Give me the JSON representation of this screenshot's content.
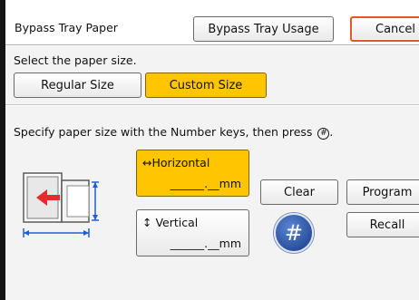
{
  "header": {
    "title": "Bypass Tray Paper",
    "usage_button": "Bypass Tray Usage",
    "cancel_button": "Cancel"
  },
  "paper_size": {
    "prompt": "Select the paper size.",
    "options": [
      {
        "label": "Regular Size",
        "selected": false
      },
      {
        "label": "Custom Size",
        "selected": true
      }
    ]
  },
  "custom": {
    "instruction": "Specify paper size with the Number keys, then press",
    "instruction_end": ".",
    "hash_glyph": "#",
    "horizontal": {
      "label": "↔Horizontal",
      "value": "______.__mm"
    },
    "vertical": {
      "label": "↕ Vertical",
      "value": "______.__mm"
    },
    "clear_button": "Clear",
    "program_button": "Program",
    "recall_button": "Recall",
    "hash_button": "#"
  },
  "colors": {
    "selected": "#ffc600",
    "cancel_border": "#e8542a",
    "tray_arrow": "#e52b2b",
    "dimension_lines": "#1f5fd6"
  },
  "icons": {
    "tray": "bypass-tray-icon",
    "enter": "enter-hash-icon"
  }
}
